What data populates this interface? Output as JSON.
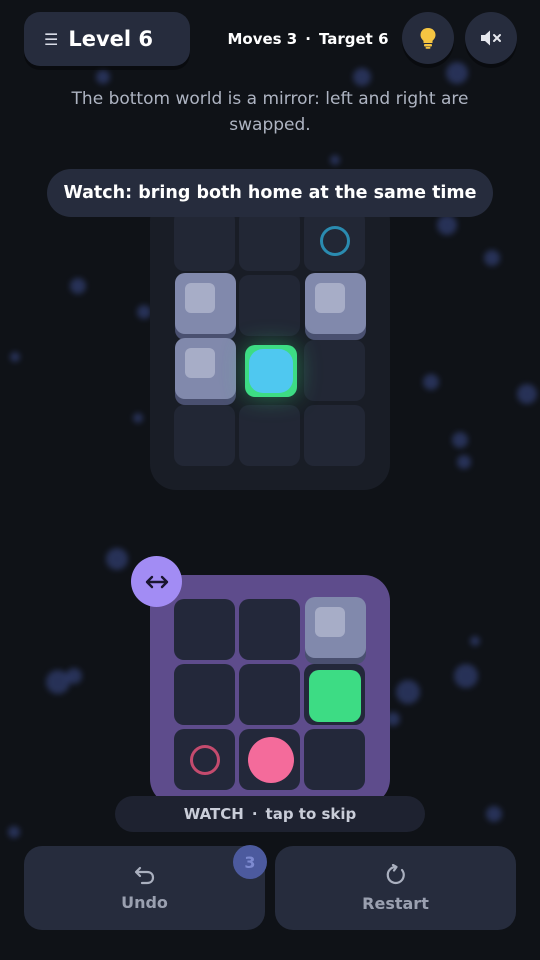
{
  "header": {
    "level_label": "Level 6",
    "moves": "Moves 3",
    "separator": "·",
    "target": "Target 6",
    "menu_icon": "menu-icon",
    "hint_icon": "lightbulb-icon",
    "sound_icon": "mute-icon"
  },
  "subtitle": "The bottom world is a mirror: left and right are swapped.",
  "banner": "Watch: bring both home at the same time",
  "watch_bar": {
    "mode": "WATCH",
    "separator": "·",
    "action": "tap to skip"
  },
  "buttons": {
    "undo_label": "Undo",
    "undo_count": "3",
    "restart_label": "Restart"
  },
  "colors": {
    "background": "#0f1217",
    "panel": "#262c3d",
    "mirror_board": "#5e4c8c",
    "mirror_badge": "#a28cf4",
    "player_top": "#4fc8f0",
    "player_bottom": "#f46b9b",
    "goal_top": "#2a8bb0",
    "goal_bottom": "#c44b6e",
    "green_tile": "#3ddc84",
    "hint_bulb": "#f5c542"
  }
}
